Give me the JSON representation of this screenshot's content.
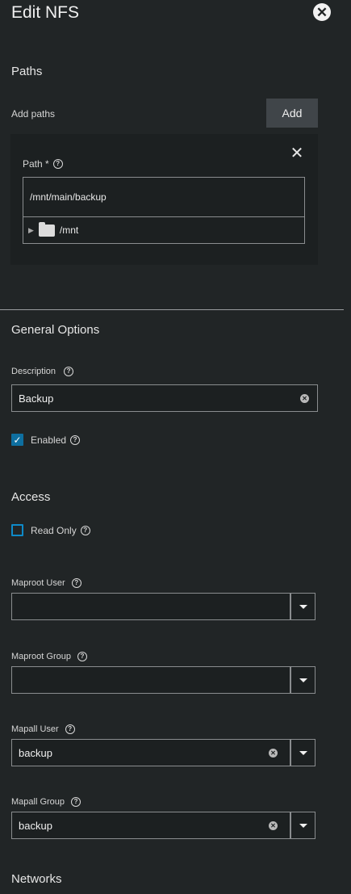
{
  "dialog": {
    "title": "Edit NFS",
    "close_icon": "close-icon"
  },
  "paths": {
    "section_title": "Paths",
    "add_label": "Add paths",
    "add_button": "Add",
    "path_label": "Path *",
    "path_value": "/mnt/main/backup",
    "tree_item": "/mnt"
  },
  "general": {
    "section_title": "General Options",
    "description_label": "Description",
    "description_value": "Backup",
    "enabled_label": "Enabled",
    "enabled_checked": true
  },
  "access": {
    "section_title": "Access",
    "read_only_label": "Read Only",
    "read_only_checked": false,
    "maproot_user_label": "Maproot User",
    "maproot_user_value": "",
    "maproot_group_label": "Maproot Group",
    "maproot_group_value": "",
    "mapall_user_label": "Mapall User",
    "mapall_user_value": "backup",
    "mapall_group_label": "Mapall Group",
    "mapall_group_value": "backup"
  },
  "networks": {
    "section_title": "Networks"
  },
  "colors": {
    "background": "#212526",
    "accent": "#0e6fa0"
  }
}
